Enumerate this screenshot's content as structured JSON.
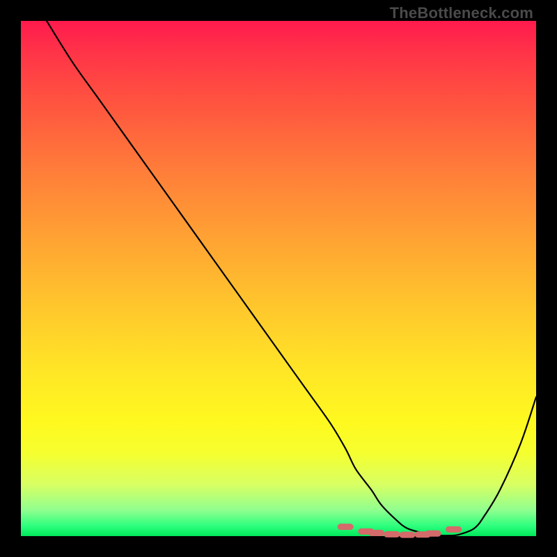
{
  "watermark": "TheBottleneck.com",
  "chart_data": {
    "type": "line",
    "title": "",
    "xlabel": "",
    "ylabel": "",
    "xlim": [
      0,
      100
    ],
    "ylim": [
      0,
      100
    ],
    "grid": false,
    "series": [
      {
        "name": "bottleneck-curve",
        "x": [
          5,
          10,
          15,
          20,
          25,
          30,
          35,
          40,
          45,
          50,
          55,
          60,
          63,
          65,
          68,
          70,
          73,
          75,
          78,
          80,
          83,
          85,
          88,
          90,
          93,
          97,
          100
        ],
        "values": [
          100,
          92,
          85,
          78,
          71,
          64,
          57,
          50,
          43,
          36,
          29,
          22,
          17,
          13,
          9,
          6,
          3,
          1.5,
          0.6,
          0.2,
          0.1,
          0.3,
          1.5,
          4,
          9,
          18,
          27
        ]
      }
    ],
    "markers": {
      "name": "highlight-dots",
      "color": "#d46a6a",
      "points": [
        {
          "x": 63,
          "y": 1.8
        },
        {
          "x": 67,
          "y": 0.9
        },
        {
          "x": 69,
          "y": 0.6
        },
        {
          "x": 72,
          "y": 0.35
        },
        {
          "x": 75,
          "y": 0.25
        },
        {
          "x": 78,
          "y": 0.3
        },
        {
          "x": 80,
          "y": 0.5
        },
        {
          "x": 84,
          "y": 1.3
        }
      ]
    }
  }
}
